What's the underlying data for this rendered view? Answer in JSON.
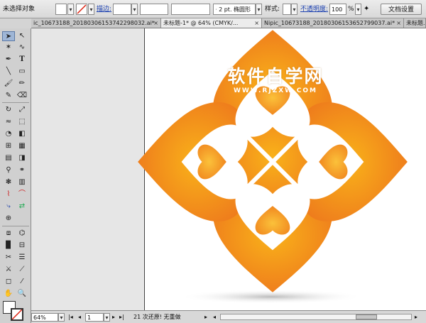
{
  "control_bar": {
    "selection_status": "未选择对象",
    "stroke_label": "描边:",
    "stroke_profile": "2 pt. 椭圆形",
    "style_label": "样式:",
    "opacity_label": "不透明度:",
    "opacity_value": "100",
    "opacity_unit": "%",
    "doc_setup_button": "文档设置"
  },
  "tabs": [
    {
      "label": "ic_10673188_2018030615374229803​2.ai*",
      "close": "×"
    },
    {
      "label": "未标题-1* @ 64% (CMYK/...",
      "close": "×"
    },
    {
      "label": "Nipic_10673188_20180306153652799037.ai*",
      "close": "×"
    },
    {
      "label": "未标题...",
      "close": ""
    }
  ],
  "watermark": {
    "title": "软件自学网",
    "subtitle": "WWW.RJZXW.COM"
  },
  "status_bar": {
    "zoom": "64%",
    "page": "1",
    "status_text": "21 次还原! 无重做"
  },
  "colors": {
    "orange_dark": "#ee7a1c",
    "orange_light": "#f9b21a",
    "selected_tool": "#9fb6d6"
  },
  "icons": [
    "fill-none-icon",
    "stroke-slash-icon",
    "selection-tool-icon",
    "direct-selection-tool-icon",
    "magic-wand-icon",
    "lasso-icon",
    "pen-icon",
    "type-icon",
    "line-icon",
    "rectangle-icon",
    "paintbrush-icon",
    "pencil-icon",
    "rotate-icon",
    "scale-icon",
    "warp-icon",
    "free-transform-icon",
    "symbol-sprayer-icon",
    "graph-icon",
    "mesh-icon",
    "gradient-icon",
    "eyedropper-icon",
    "blend-icon",
    "live-paint-icon",
    "slice-icon",
    "eraser-icon",
    "scissors-icon",
    "hand-icon",
    "zoom-icon",
    "fill-swatch-icon",
    "stroke-swatch-icon",
    "screen-mode-icon"
  ]
}
